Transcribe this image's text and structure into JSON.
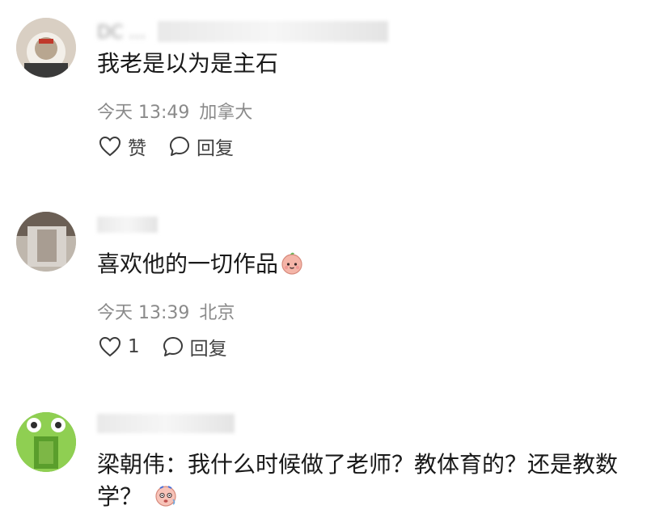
{
  "comments": [
    {
      "username": "DC ...",
      "text": "我老是以为是主石",
      "time": "今天 13:49",
      "location": "加拿大",
      "like_label": "赞",
      "reply_label": "回复"
    },
    {
      "username": "",
      "text": "喜欢他的一切作品",
      "time": "今天 13:39",
      "location": "北京",
      "like_label": "1",
      "reply_label": "回复"
    },
    {
      "username": "",
      "text_line1": "梁朝伟：我什么时候做了老师？教体育的？还是教数",
      "text_line2": "学？"
    }
  ],
  "icons": {
    "like": "heart-outline-icon",
    "reply": "speech-bubble-icon"
  },
  "colors": {
    "meta": "#8a8a8a",
    "text": "#1a1a1a",
    "background": "#ffffff"
  }
}
